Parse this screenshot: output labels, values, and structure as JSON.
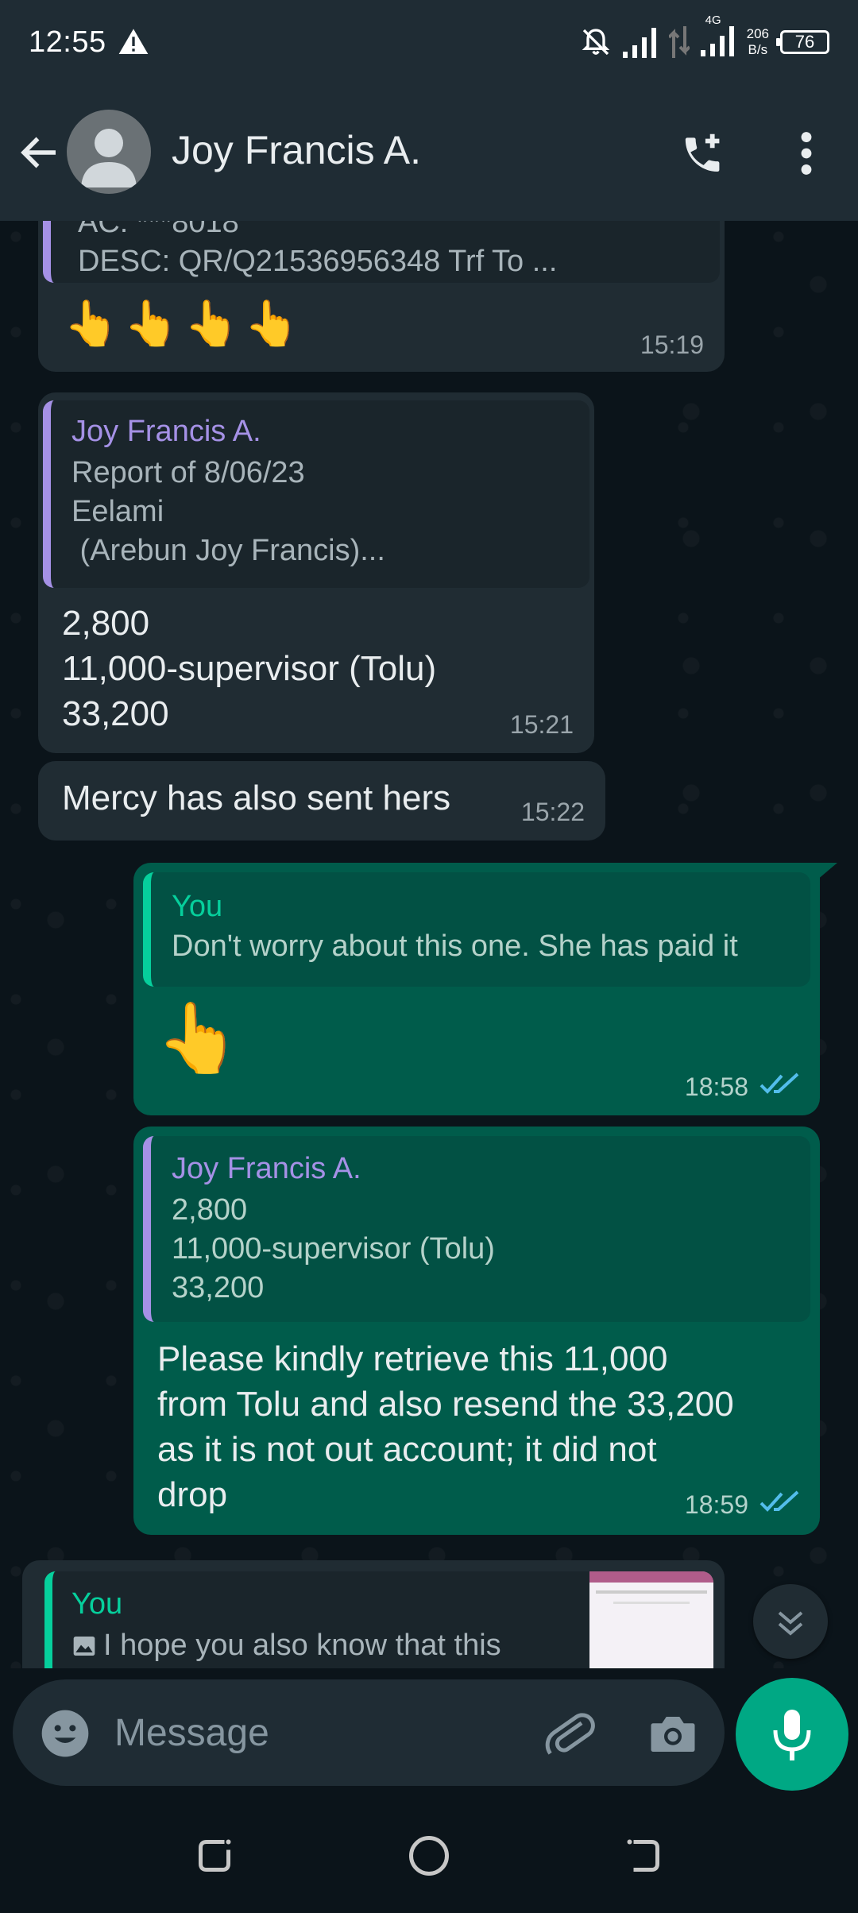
{
  "status_bar": {
    "time": "12:55",
    "network_type": "4G",
    "speed_value": "206",
    "speed_unit": "B/s",
    "battery": "76"
  },
  "header": {
    "contact_name": "Joy Francis A.",
    "back_icon": "arrow-left-icon",
    "call_icon": "add-call-icon",
    "menu_icon": "more-vertical-icon"
  },
  "messages": [
    {
      "direction": "incoming",
      "quote_lines": [
        "AC: ***8018",
        "DESC:  QR/Q21536956348 Trf To ..."
      ],
      "emoji": "👆👆👆👆",
      "time": "15:19"
    },
    {
      "direction": "incoming",
      "quote_author": "Joy Francis A.",
      "quote_lines": [
        "Report of 8/06/23",
        "Eelami",
        " (Arebun Joy Francis)..."
      ],
      "text": "2,800\n11,000-supervisor (Tolu)\n33,200",
      "time": "15:21"
    },
    {
      "direction": "incoming",
      "text": "Mercy has also sent hers",
      "time": "15:22"
    },
    {
      "direction": "outgoing",
      "quote_author": "You",
      "quote_lines": [
        "Don't worry about this one. She has paid it"
      ],
      "emoji": "👆",
      "time": "18:58",
      "status": "read"
    },
    {
      "direction": "outgoing",
      "quote_author": "Joy Francis A.",
      "quote_lines": [
        "2,800",
        "11,000-supervisor (Tolu)",
        "33,200"
      ],
      "text": "Please kindly retrieve this 11,000\nfrom Tolu and also resend the 33,200\nas it is not out account; it did not\ndrop",
      "time": "18:59",
      "status": "read"
    },
    {
      "direction": "incoming",
      "quote_author": "You",
      "quote_lines": [
        "I hope you also know that this"
      ],
      "quote_thumbnail": "image"
    }
  ],
  "input_bar": {
    "placeholder": "Message",
    "emoji_icon": "emoji-icon",
    "attach_icon": "paperclip-icon",
    "camera_icon": "camera-icon",
    "mic_icon": "microphone-icon"
  },
  "colors": {
    "background": "#0b141a",
    "header": "#1f2c34",
    "incoming_bubble": "#202c33",
    "outgoing_bubble": "#005c4b",
    "accent_green": "#00a884",
    "you_label": "#06cf9c",
    "contact_label": "#a591e6",
    "read_ticks": "#53bdeb"
  }
}
